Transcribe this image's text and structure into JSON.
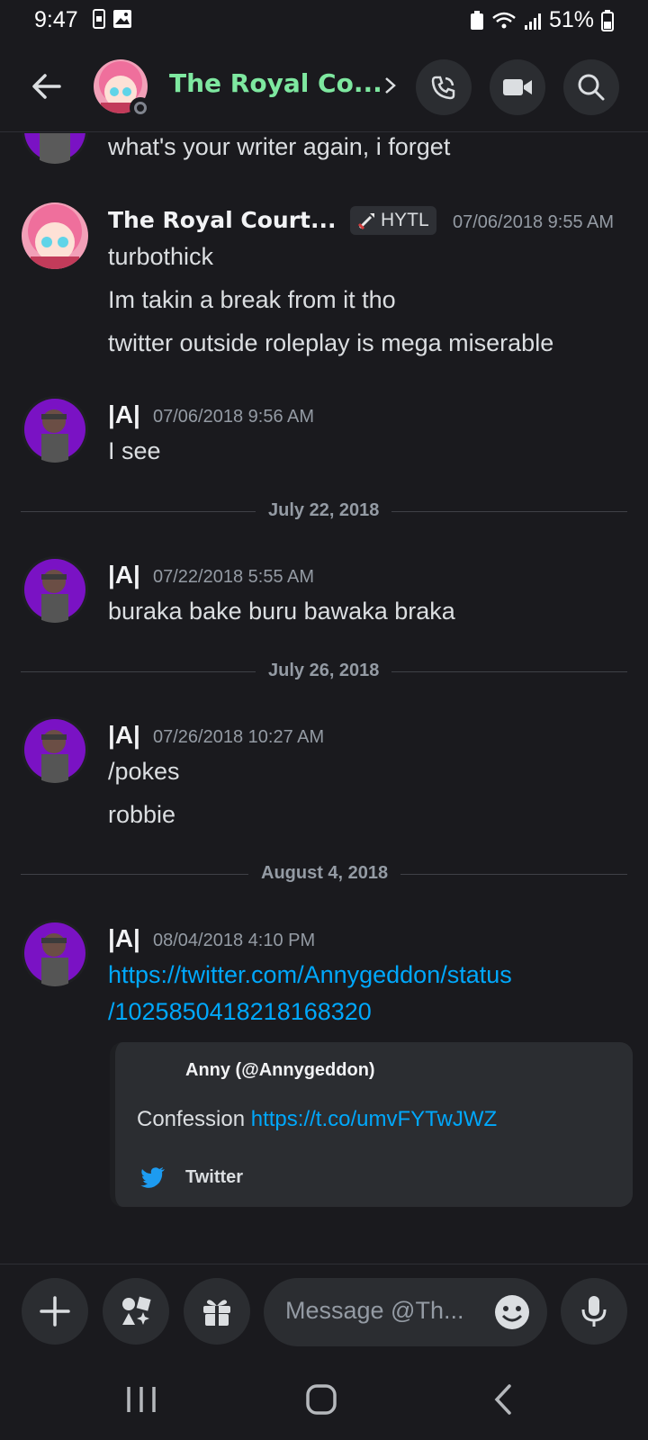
{
  "status_bar": {
    "time": "9:47",
    "battery": "51%"
  },
  "header": {
    "title": "The Royal Co..."
  },
  "messages": {
    "top_fragment": "what's your writer again, i forget",
    "group1": {
      "username": "The Royal Court...",
      "badge": "HYTL",
      "timestamp": "07/06/2018 9:55 AM",
      "lines": [
        "turbothick",
        "Im takin a break from it tho",
        "twitter outside roleplay is mega miserable"
      ]
    },
    "group2": {
      "username": "|A|",
      "timestamp": "07/06/2018 9:56 AM",
      "lines": [
        "I see"
      ]
    },
    "divider1": "July 22, 2018",
    "group3": {
      "username": "|A|",
      "timestamp": "07/22/2018 5:55 AM",
      "lines": [
        "buraka bake buru bawaka braka"
      ]
    },
    "divider2": "July 26, 2018",
    "group4": {
      "username": "|A|",
      "timestamp": "07/26/2018 10:27 AM",
      "lines": [
        "/pokes",
        "robbie"
      ]
    },
    "divider3": "August 4, 2018",
    "group5": {
      "username": "|A|",
      "timestamp": "08/04/2018 4:10 PM",
      "link_line1": "https://twitter.com/Annygeddon/status",
      "link_line2": "/1025850418218168320",
      "embed": {
        "author": "Anny (@Annygeddon)",
        "text": "Confession ",
        "link": "https://t.co/umvFYTwJWZ",
        "footer": "Twitter"
      }
    }
  },
  "composer": {
    "placeholder": "Message @Th..."
  },
  "colors": {
    "accent_title": "#7ee8a0",
    "link": "#00a8fc",
    "background": "#1a1a1e",
    "twitter": "#1d9bf0"
  }
}
